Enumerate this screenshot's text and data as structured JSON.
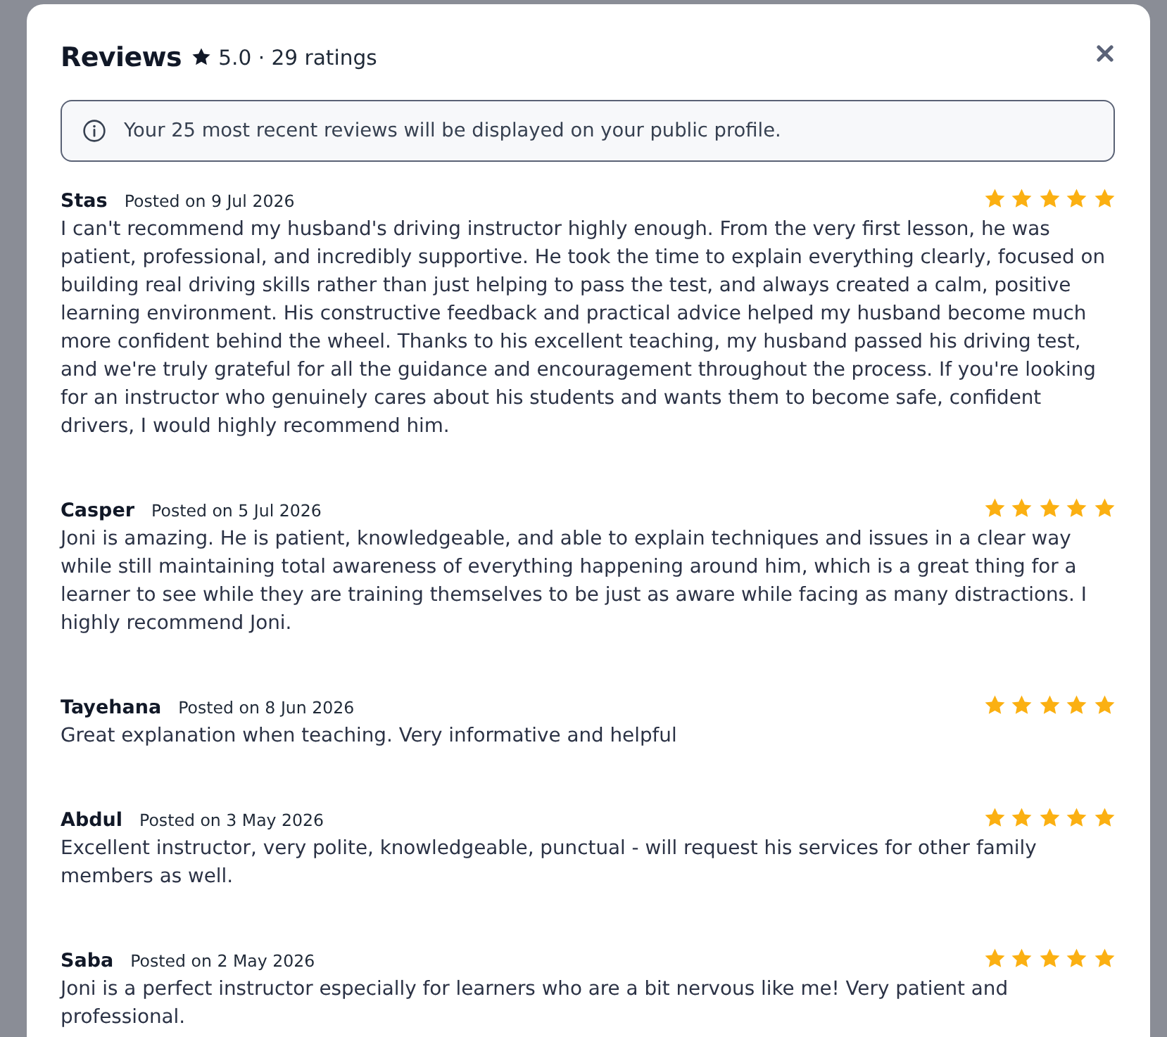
{
  "dialog": {
    "title": "Reviews",
    "rating_summary": "5.0 · 29 ratings",
    "notice": "Your 25 most recent reviews will be displayed on your public profile."
  },
  "reviews": [
    {
      "author": "Stas",
      "date": "Posted on 9 Jul 2026",
      "stars": 5,
      "text": "I can't recommend my husband's driving instructor highly enough. From the very first lesson, he was patient, professional, and incredibly supportive. He took the time to explain everything clearly, focused on building real driving skills rather than just helping to pass the test, and always created a calm, positive learning environment. His constructive feedback and practical advice helped my husband become much more confident behind the wheel. Thanks to his excellent teaching, my husband passed his driving test, and we're truly grateful for all the guidance and encouragement throughout the process. If you're looking for an instructor who genuinely cares about his students and wants them to become safe, confident drivers, I would highly recommend him."
    },
    {
      "author": "Casper",
      "date": "Posted on 5 Jul 2026",
      "stars": 5,
      "text": "Joni is amazing. He is patient, knowledgeable, and able to explain techniques and issues in a clear way while still maintaining total awareness of everything happening around him, which is a great thing for a learner to see while they are training themselves to be just as aware while facing as many distractions. I highly recommend Joni."
    },
    {
      "author": "Tayehana",
      "date": "Posted on 8 Jun 2026",
      "stars": 5,
      "text": "Great explanation when teaching. Very informative and helpful"
    },
    {
      "author": "Abdul",
      "date": "Posted on 3 May 2026",
      "stars": 5,
      "text": "Excellent instructor, very polite, knowledgeable, punctual - will request his services for other family members as well."
    },
    {
      "author": "Saba",
      "date": "Posted on 2 May 2026",
      "stars": 5,
      "text": "Joni is a perfect instructor especially for learners who are a bit nervous like me! Very patient and professional."
    }
  ]
}
